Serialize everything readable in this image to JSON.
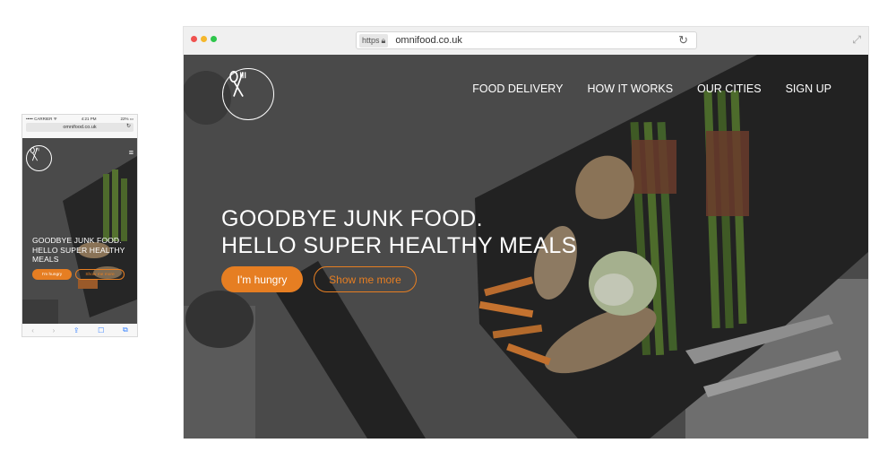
{
  "mobile": {
    "status": {
      "carrier": "••••• CARRIER ᯤ",
      "time": "4:21 PM",
      "battery": "22% ▭"
    },
    "url": "omnifood.co.uk",
    "headline_line1": "GOODBYE JUNK FOOD.",
    "headline_line2": "HELLO SUPER HEALTHY",
    "headline_line3": "MEALS",
    "primary_button": "I'm hungry",
    "secondary_button": "Show me more"
  },
  "browser": {
    "url_scheme": "https",
    "url": "omnifood.co.uk",
    "window_dots": [
      "#f0524f",
      "#f5b72c",
      "#2ec64b"
    ],
    "nav": {
      "item1": "FOOD DELIVERY",
      "item2": "HOW IT WORKS",
      "item3": "OUR CITIES",
      "item4": "SIGN UP"
    },
    "headline_line1": "GOODBYE JUNK FOOD.",
    "headline_line2": "HELLO SUPER HEALTHY MEALS",
    "primary_button": "I'm hungry",
    "secondary_button": "Show me more"
  },
  "colors": {
    "accent": "#e67e22",
    "hero_overlay": "#474747"
  },
  "icons": [
    "fork-knife-spoon-logo-icon",
    "lock-icon",
    "reload-icon",
    "expand-icon",
    "hamburger-menu-icon",
    "back-icon",
    "forward-icon",
    "share-icon",
    "bookmarks-icon",
    "tabs-icon"
  ]
}
